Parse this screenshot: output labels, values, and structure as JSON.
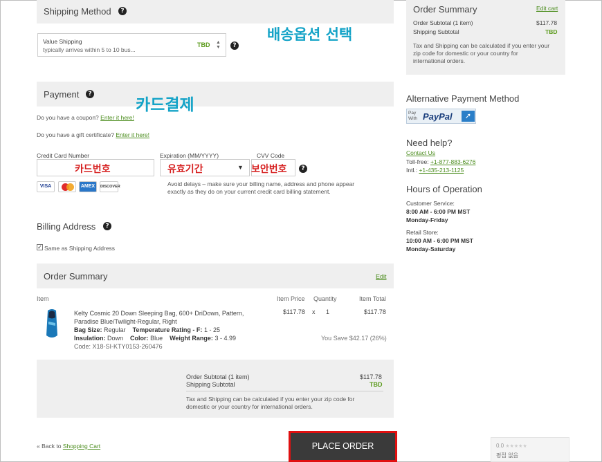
{
  "shipping": {
    "title": "Shipping Method",
    "option_name": "Value Shipping",
    "option_desc": "typically arrives within 5 to 10 bus...",
    "option_price": "TBD",
    "annotation": "배송옵션 선택"
  },
  "payment": {
    "title": "Payment",
    "annotation": "카드결제",
    "coupon_text": "Do you have a coupon?",
    "coupon_link": "Enter it here!",
    "gift_text": "Do you have a gift certificate?",
    "gift_link": "Enter it here!",
    "cc_label": "Credit Card Number",
    "cc_annotation": "카드번호",
    "exp_label": "Expiration (MM/YYYY)",
    "exp_annotation": "유효기간",
    "cvv_label": "CVV Code",
    "cvv_annotation": "보안번호",
    "cards": [
      "VISA",
      "MC",
      "AMEX",
      "DISCOVER"
    ],
    "notice_line1": "Avoid delays – make sure your billing name, address and phone appear",
    "notice_line2": "exactly as they do on your current credit card billing statement."
  },
  "billing": {
    "title": "Billing Address",
    "same_label": "Same as Shipping Address",
    "same_checked": true
  },
  "order": {
    "title": "Order Summary",
    "edit": "Edit",
    "col_item": "Item",
    "col_price": "Item Price",
    "col_qty": "Quantity",
    "col_total": "Item Total",
    "item": {
      "name_line1": "Kelty Cosmic 20 Down Sleeping Bag, 600+ DriDown, Pattern,",
      "name_line2": "Paradise Blue/Twilight-Regular, Right",
      "bag_size_label": "Bag Size:",
      "bag_size": "Regular",
      "temp_label": "Temperature Rating - F:",
      "temp": "1 - 25",
      "insulation_label": "Insulation:",
      "insulation": "Down",
      "color_label": "Color:",
      "color": "Blue",
      "weight_label": "Weight Range:",
      "weight": "3 - 4.99",
      "code": "Code: X18-SI-KTY0153-260476",
      "price": "$117.78",
      "times": "x",
      "qty": "1",
      "total": "$117.78",
      "savings": "You Save $42.17 (26%)"
    },
    "subtotal_label": "Order Subtotal (1 item)",
    "subtotal": "$117.78",
    "shipping_label": "Shipping Subtotal",
    "shipping": "TBD",
    "tax_line1": "Tax and Shipping can be calculated if you enter your zip code for",
    "tax_line2": "domestic or your country for international orders."
  },
  "footer": {
    "back_prefix": "« Back to",
    "back_link": "Shopping Cart",
    "place_order": "PLACE ORDER"
  },
  "sidebar": {
    "summary": {
      "title": "Order Summary",
      "edit_cart": "Edit cart",
      "subtotal_label": "Order Subtotal (1 item)",
      "subtotal": "$117.78",
      "shipping_label": "Shipping Subtotal",
      "shipping": "TBD",
      "tax_line1": "Tax and Shipping can be calculated if you enter your",
      "tax_line2": "zip code for domestic or your country for",
      "tax_line3": "international orders."
    },
    "alt_payment": {
      "title": "Alternative Payment Method",
      "paypal_pay": "Pay",
      "paypal_with": "With",
      "paypal_brand": "PayPal"
    },
    "help": {
      "title": "Need help?",
      "contact": "Contact Us",
      "tollfree_label": "Toll-free:",
      "tollfree": "+1-877-883-6276",
      "intl_label": "Intl.:",
      "intl": "+1-435-213-1125"
    },
    "hours": {
      "title": "Hours of Operation",
      "cs_label": "Customer Service:",
      "cs_time": "8:00 AM - 6:00 PM MST",
      "cs_days": "Monday-Friday",
      "rs_label": "Retail Store:",
      "rs_time": "10:00 AM - 6:00 PM MST",
      "rs_days": "Monday-Saturday"
    },
    "rating": {
      "score": "0.0",
      "stars": "★★★★★",
      "text": "평점 없음"
    }
  },
  "colors": {
    "accent_green": "#5a9a1a",
    "annotation_cyan": "#14a3c7",
    "annotation_red": "#d61f1f",
    "place_order_bg": "#3a3a3a"
  }
}
